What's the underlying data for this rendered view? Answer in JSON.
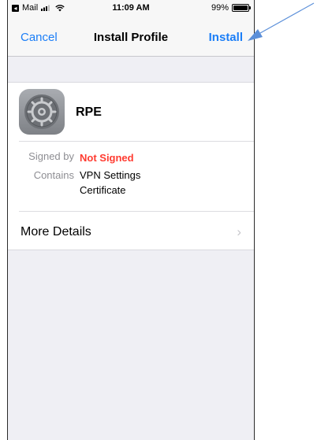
{
  "status_bar": {
    "back_app": "Mail",
    "time": "11:09 AM",
    "battery_percent": "99%",
    "battery_level": 0.99
  },
  "navbar": {
    "cancel_label": "Cancel",
    "title": "Install Profile",
    "install_label": "Install"
  },
  "profile": {
    "name": "RPE",
    "icon": "settings-gear-icon",
    "signed_by_label": "Signed by",
    "signed_by_value": "Not Signed",
    "contains_label": "Contains",
    "contains_values": [
      "VPN Settings",
      "Certificate"
    ],
    "more_details_label": "More Details"
  },
  "colors": {
    "accent": "#1b7ef7",
    "warning": "#ff3b30",
    "annotation_arrow": "#5b8fd9"
  }
}
